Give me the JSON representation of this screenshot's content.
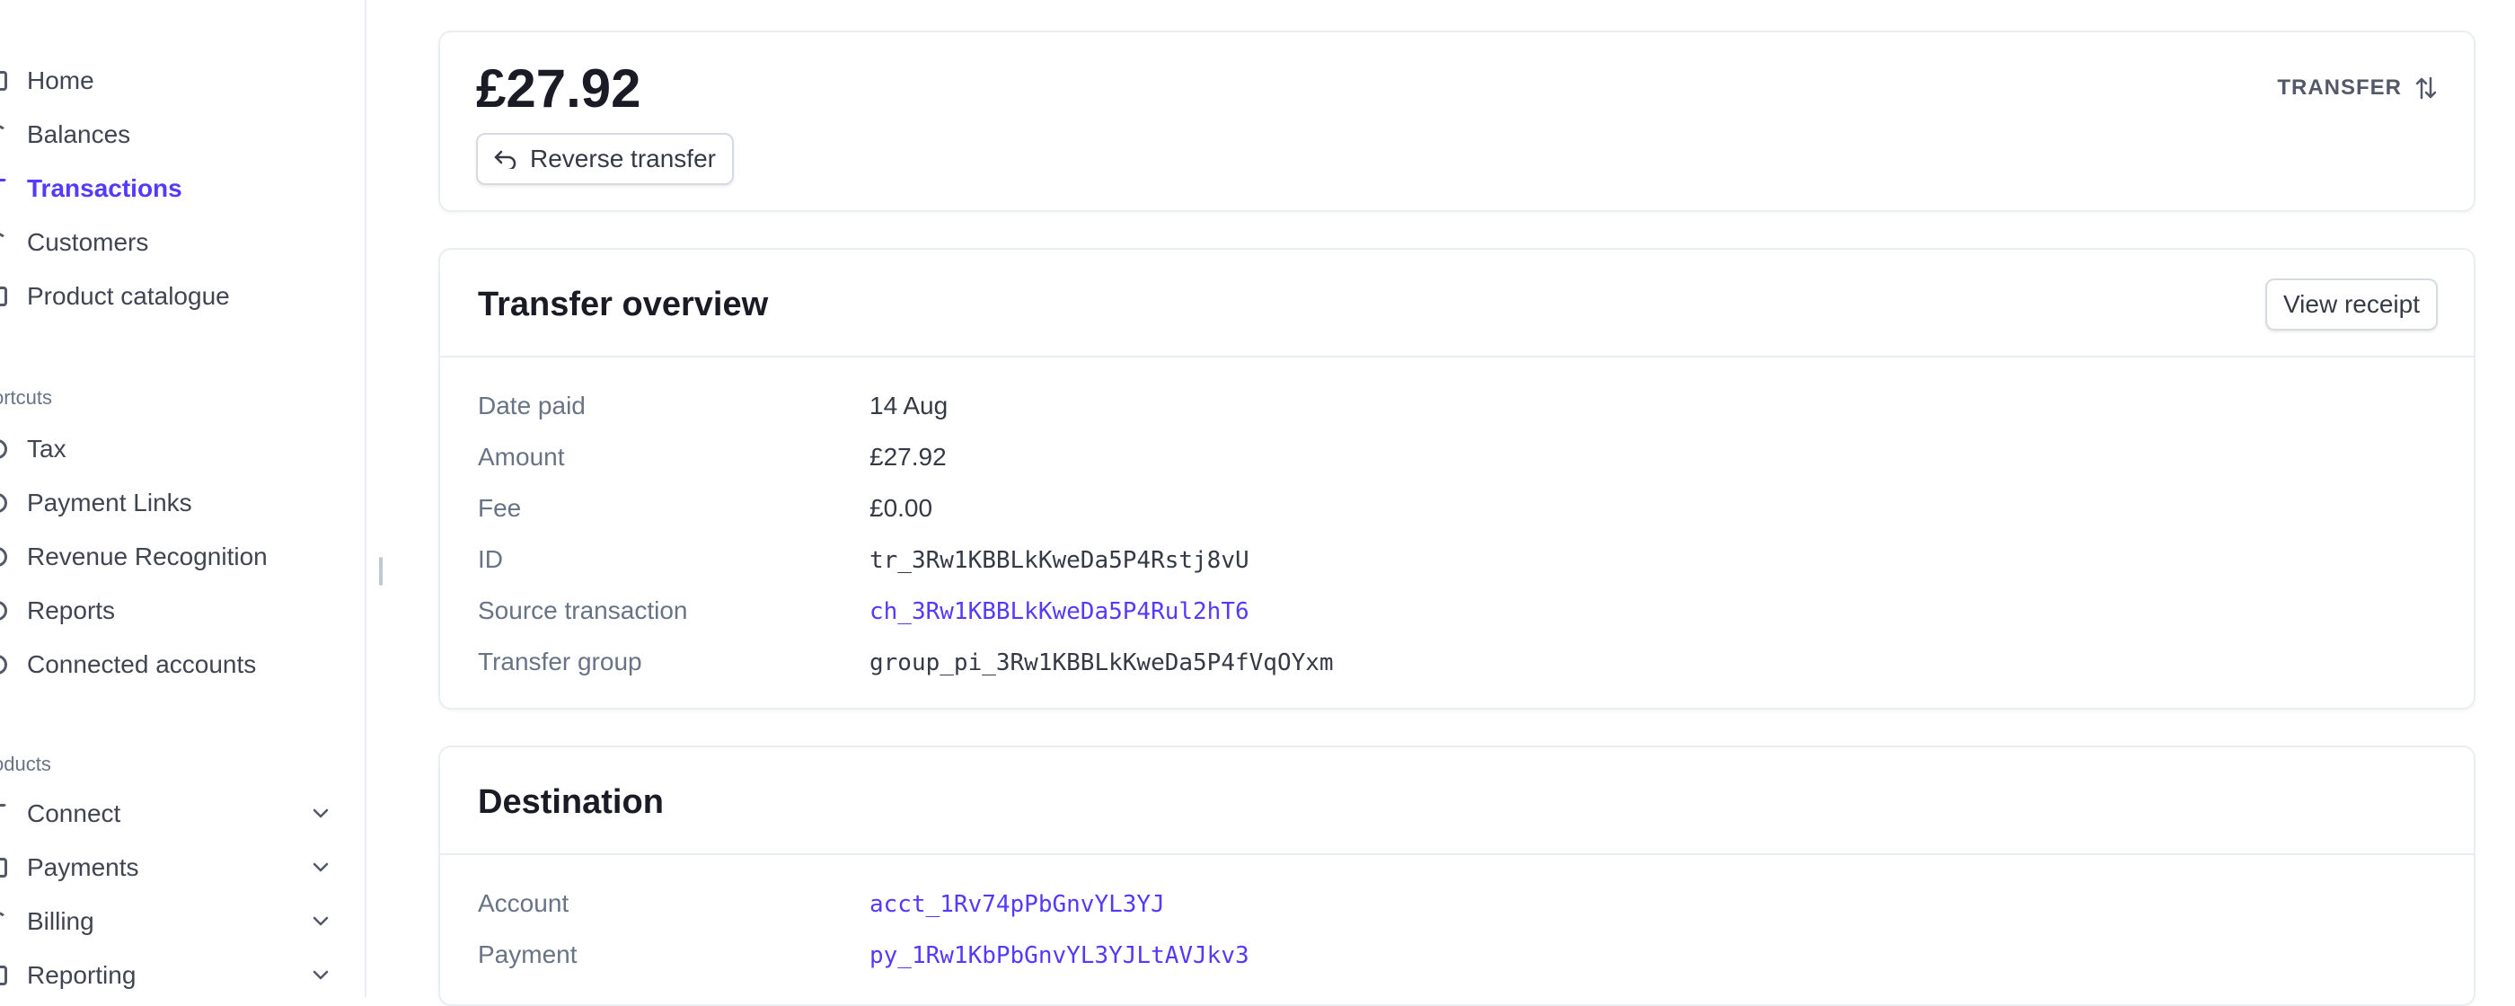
{
  "sidebar": {
    "main_items": [
      {
        "label": "Home"
      },
      {
        "label": "Balances"
      },
      {
        "label": "Transactions"
      },
      {
        "label": "Customers"
      },
      {
        "label": "Product catalogue"
      }
    ],
    "shortcuts_heading": "ortcuts",
    "shortcuts": [
      {
        "label": "Tax"
      },
      {
        "label": "Payment Links"
      },
      {
        "label": "Revenue Recognition"
      },
      {
        "label": "Reports"
      },
      {
        "label": "Connected accounts"
      }
    ],
    "products_heading": "oducts",
    "products": [
      {
        "label": "Connect"
      },
      {
        "label": "Payments"
      },
      {
        "label": "Billing"
      },
      {
        "label": "Reporting"
      }
    ]
  },
  "header": {
    "amount": "£27.92",
    "reverse_button": "Reverse transfer",
    "type_label": "TRANSFER"
  },
  "overview": {
    "title": "Transfer overview",
    "view_receipt": "View receipt",
    "rows": [
      {
        "label": "Date paid",
        "value": "14 Aug"
      },
      {
        "label": "Amount",
        "value": "£27.92"
      },
      {
        "label": "Fee",
        "value": "£0.00"
      },
      {
        "label": "ID",
        "value": "tr_3Rw1KBBLkKweDa5P4Rstj8vU"
      },
      {
        "label": "Source transaction",
        "value": "ch_3Rw1KBBLkKweDa5P4Rul2hT6"
      },
      {
        "label": "Transfer group",
        "value": "group_pi_3Rw1KBBLkKweDa5P4fVqOYxm"
      }
    ]
  },
  "destination": {
    "title": "Destination",
    "rows": [
      {
        "label": "Account",
        "value": "acct_1Rv74pPbGnvYL3YJ"
      },
      {
        "label": "Payment",
        "value": "py_1Rw1KbPbGnvYL3YJLtAVJkv3"
      }
    ]
  },
  "colors": {
    "accent": "#533afd",
    "border": "#ebeef1",
    "text_primary": "#1a1b25",
    "text_secondary": "#687385"
  },
  "icons": {
    "reverse": "undo-arrow-icon",
    "transfer": "swap-vertical-icon",
    "expand": "chevron-down-icon"
  }
}
